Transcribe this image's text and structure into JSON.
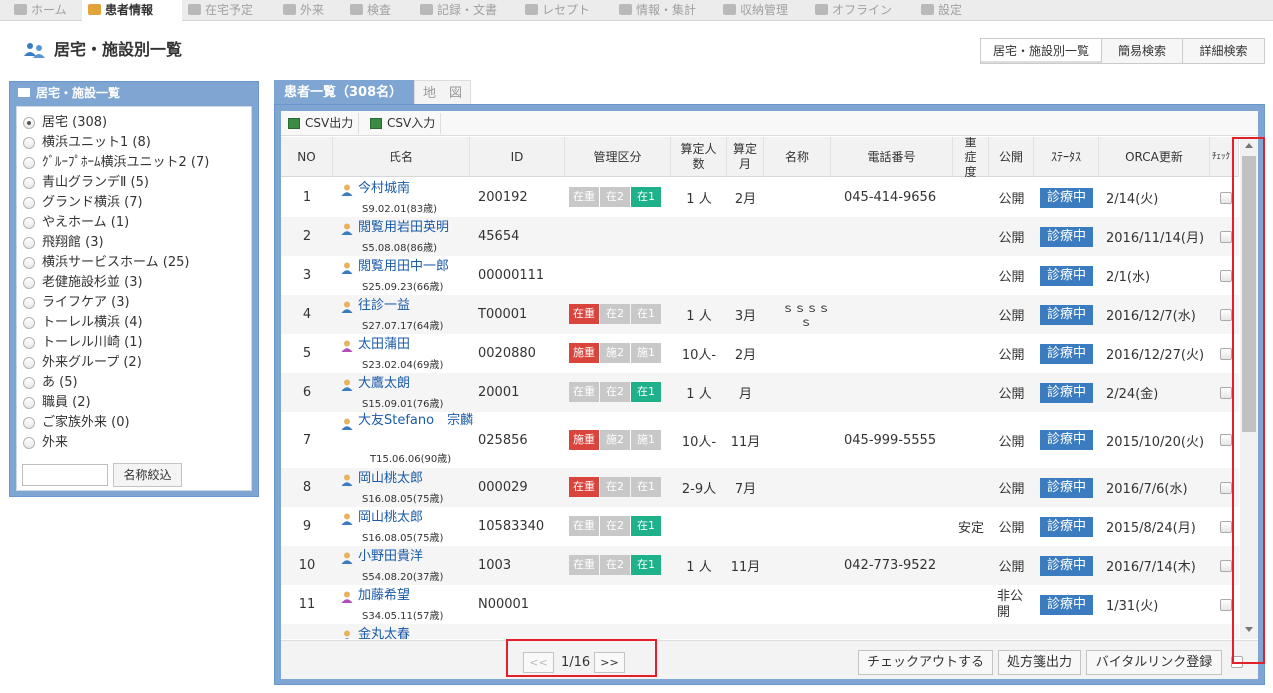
{
  "nav": [
    {
      "label": "ホーム",
      "icon": "home-icon",
      "active": false
    },
    {
      "label": "患者情報",
      "icon": "patient-icon",
      "active": true
    },
    {
      "label": "在宅予定",
      "icon": "clock-icon",
      "active": false
    },
    {
      "label": "外来",
      "icon": "outpatient-icon",
      "active": false
    },
    {
      "label": "検査",
      "icon": "chart-icon",
      "active": false
    },
    {
      "label": "記録・文書",
      "icon": "document-icon",
      "active": false
    },
    {
      "label": "レセプト",
      "icon": "receipt-icon",
      "active": false
    },
    {
      "label": "情報・集計",
      "icon": "database-icon",
      "active": false
    },
    {
      "label": "収納管理",
      "icon": "tag-icon",
      "active": false
    },
    {
      "label": "オフライン",
      "icon": "plug-icon",
      "active": false
    },
    {
      "label": "設定",
      "icon": "gear-icon",
      "active": false
    }
  ],
  "page": {
    "title": "居宅・施設別一覧"
  },
  "top_buttons": [
    {
      "label": "居宅・施設別一覧",
      "active": true
    },
    {
      "label": "簡易検索",
      "active": false
    },
    {
      "label": "詳細検索",
      "active": false
    }
  ],
  "sidebar": {
    "header": "居宅・施設一覧",
    "facilities": [
      {
        "label": "居宅 (308)",
        "checked": true
      },
      {
        "label": "横浜ユニット1 (8)",
        "checked": false
      },
      {
        "label": "ｸﾞﾙｰﾌﾟﾎｰﾑ横浜ユニット2 (7)",
        "checked": false
      },
      {
        "label": "青山グランデⅡ (5)",
        "checked": false
      },
      {
        "label": "グランド横浜 (7)",
        "checked": false
      },
      {
        "label": "やえホーム (1)",
        "checked": false
      },
      {
        "label": "飛翔館 (3)",
        "checked": false
      },
      {
        "label": "横浜サービスホーム (25)",
        "checked": false
      },
      {
        "label": "老健施設杉並 (3)",
        "checked": false
      },
      {
        "label": "ライフケア (3)",
        "checked": false
      },
      {
        "label": "トーレル横浜 (4)",
        "checked": false
      },
      {
        "label": "トーレル川崎 (1)",
        "checked": false
      },
      {
        "label": "外来グループ (2)",
        "checked": false
      },
      {
        "label": "あ (5)",
        "checked": false
      },
      {
        "label": "職員 (2)",
        "checked": false
      },
      {
        "label": "ご家族外来 (0)",
        "checked": false
      },
      {
        "label": "外来",
        "checked": false
      }
    ],
    "filter_value": "",
    "filter_button": "名称絞込"
  },
  "main": {
    "tab_active": "患者一覧（308名）",
    "tab_map": "地　図",
    "csv_out": "CSV出力",
    "csv_in": "CSV入力",
    "columns": [
      "NO",
      "氏名",
      "ID",
      "管理区分",
      "算定人数",
      "算定月",
      "名称",
      "電話番号",
      "重症度",
      "公開",
      "ｽﾃｰﾀｽ",
      "ORCA更新",
      "ﾁｪｯｸ"
    ],
    "rows": [
      {
        "no": "1",
        "name": "今村城南",
        "dob": "S9.02.01(83歳)",
        "id": "200192",
        "badges": [
          {
            "t": "在重",
            "c": "gray"
          },
          {
            "t": "在2",
            "c": "gray"
          },
          {
            "t": "在1",
            "c": "green"
          }
        ],
        "count": "1 人",
        "month": "2月",
        "meisho": "",
        "phone": "045-414-9656",
        "severity": "",
        "pub": "公開",
        "status": "診療中",
        "orca": "2/14(火)",
        "icon_color": "#3b7cc0"
      },
      {
        "no": "2",
        "name": "閲覧用岩田英明",
        "dob": "S5.08.08(86歳)",
        "id": "45654",
        "badges": [],
        "count": "",
        "month": "",
        "meisho": "",
        "phone": "",
        "severity": "",
        "pub": "公開",
        "status": "診療中",
        "orca": "2016/11/14(月)",
        "icon_color": "#3b7cc0"
      },
      {
        "no": "3",
        "name": "閲覧用田中一郎",
        "dob": "S25.09.23(66歳)",
        "id": "00000111",
        "badges": [],
        "count": "",
        "month": "",
        "meisho": "",
        "phone": "",
        "severity": "",
        "pub": "公開",
        "status": "診療中",
        "orca": "2/1(水)",
        "icon_color": "#3b7cc0"
      },
      {
        "no": "4",
        "name": "往診一益",
        "dob": "S27.07.17(64歳)",
        "id": "T00001",
        "badges": [
          {
            "t": "在重",
            "c": "red"
          },
          {
            "t": "在2",
            "c": "gray"
          },
          {
            "t": "在1",
            "c": "gray"
          }
        ],
        "count": "1 人",
        "month": "3月",
        "meisho": "ｓｓｓｓ",
        "meisho2": "ｓ",
        "phone": "",
        "severity": "",
        "pub": "公開",
        "status": "診療中",
        "orca": "2016/12/7(水)",
        "icon_color": "#3b7cc0"
      },
      {
        "no": "5",
        "name": "太田蒲田",
        "dob": "S23.02.04(69歳)",
        "id": "0020880",
        "badges": [
          {
            "t": "施重",
            "c": "red"
          },
          {
            "t": "施2",
            "c": "gray"
          },
          {
            "t": "施1",
            "c": "gray"
          }
        ],
        "count": "10人-",
        "month": "2月",
        "meisho": "",
        "phone": "",
        "severity": "",
        "pub": "公開",
        "status": "診療中",
        "orca": "2016/12/27(火)",
        "icon_color": "#b04fb8"
      },
      {
        "no": "6",
        "name": "大鷹太朗",
        "dob": "S15.09.01(76歳)",
        "id": "20001",
        "badges": [
          {
            "t": "在重",
            "c": "gray"
          },
          {
            "t": "在2",
            "c": "gray"
          },
          {
            "t": "在1",
            "c": "green"
          }
        ],
        "count": "1 人",
        "month": "月",
        "meisho": "",
        "phone": "",
        "severity": "",
        "pub": "公開",
        "status": "診療中",
        "orca": "2/24(金)",
        "icon_color": "#3b7cc0"
      },
      {
        "no": "7",
        "name": "大友Stefano　宗麟",
        "dob": "T15.06.06(90歳)",
        "id": "025856",
        "badges": [
          {
            "t": "施重",
            "c": "red"
          },
          {
            "t": "施2",
            "c": "gray"
          },
          {
            "t": "施1",
            "c": "gray"
          }
        ],
        "count": "10人-",
        "month": "11月",
        "meisho": "",
        "phone": "045-999-5555",
        "severity": "",
        "pub": "公開",
        "status": "診療中",
        "orca": "2015/10/20(火)",
        "icon_color": "#3b7cc0",
        "tall": true
      },
      {
        "no": "8",
        "name": "岡山桃太郎",
        "dob": "S16.08.05(75歳)",
        "id": "000029",
        "badges": [
          {
            "t": "在重",
            "c": "red"
          },
          {
            "t": "在2",
            "c": "gray"
          },
          {
            "t": "在1",
            "c": "gray"
          }
        ],
        "count": "2-9人",
        "month": "7月",
        "meisho": "",
        "phone": "",
        "severity": "",
        "pub": "公開",
        "status": "診療中",
        "orca": "2016/7/6(水)",
        "icon_color": "#3b7cc0"
      },
      {
        "no": "9",
        "name": "岡山桃太郎",
        "dob": "S16.08.05(75歳)",
        "id": "10583340",
        "badges": [
          {
            "t": "在重",
            "c": "gray"
          },
          {
            "t": "在2",
            "c": "gray"
          },
          {
            "t": "在1",
            "c": "green"
          }
        ],
        "count": "",
        "month": "",
        "meisho": "",
        "phone": "",
        "severity": "安定",
        "pub": "公開",
        "status": "診療中",
        "orca": "2015/8/24(月)",
        "icon_color": "#3b7cc0"
      },
      {
        "no": "10",
        "name": "小野田貴洋",
        "dob": "S54.08.20(37歳)",
        "id": "1003",
        "badges": [
          {
            "t": "在重",
            "c": "gray"
          },
          {
            "t": "在2",
            "c": "gray"
          },
          {
            "t": "在1",
            "c": "green"
          }
        ],
        "count": "1 人",
        "month": "11月",
        "meisho": "",
        "phone": "042-773-9522",
        "severity": "",
        "pub": "公開",
        "status": "診療中",
        "orca": "2016/7/14(木)",
        "icon_color": "#3b7cc0"
      },
      {
        "no": "11",
        "name": "加藤希望",
        "dob": "S34.05.11(57歳)",
        "id": "N00001",
        "badges": [],
        "count": "",
        "month": "",
        "meisho": "",
        "phone": "",
        "severity": "",
        "pub": "非公開",
        "status": "診療中",
        "orca": "1/31(火)",
        "icon_color": "#b04fb8"
      },
      {
        "no": "",
        "name": "金丸太春",
        "dob": "",
        "id": "",
        "badges": [],
        "count": "",
        "month": "",
        "meisho": "",
        "phone": "",
        "severity": "",
        "pub": "",
        "status": "",
        "orca": "",
        "icon_color": "#3b7cc0",
        "partial": true
      }
    ],
    "pagination": {
      "prev": "<<",
      "label": "1/16",
      "next": ">>"
    },
    "footer_buttons": [
      "チェックアウトする",
      "処方箋出力",
      "バイタルリンク登録"
    ]
  },
  "colors": {
    "panel": "#7fa6d3",
    "status": "#3b7cc0",
    "badge_red": "#d9453c",
    "badge_green": "#1fb28a",
    "highlight": "#e0202a"
  }
}
